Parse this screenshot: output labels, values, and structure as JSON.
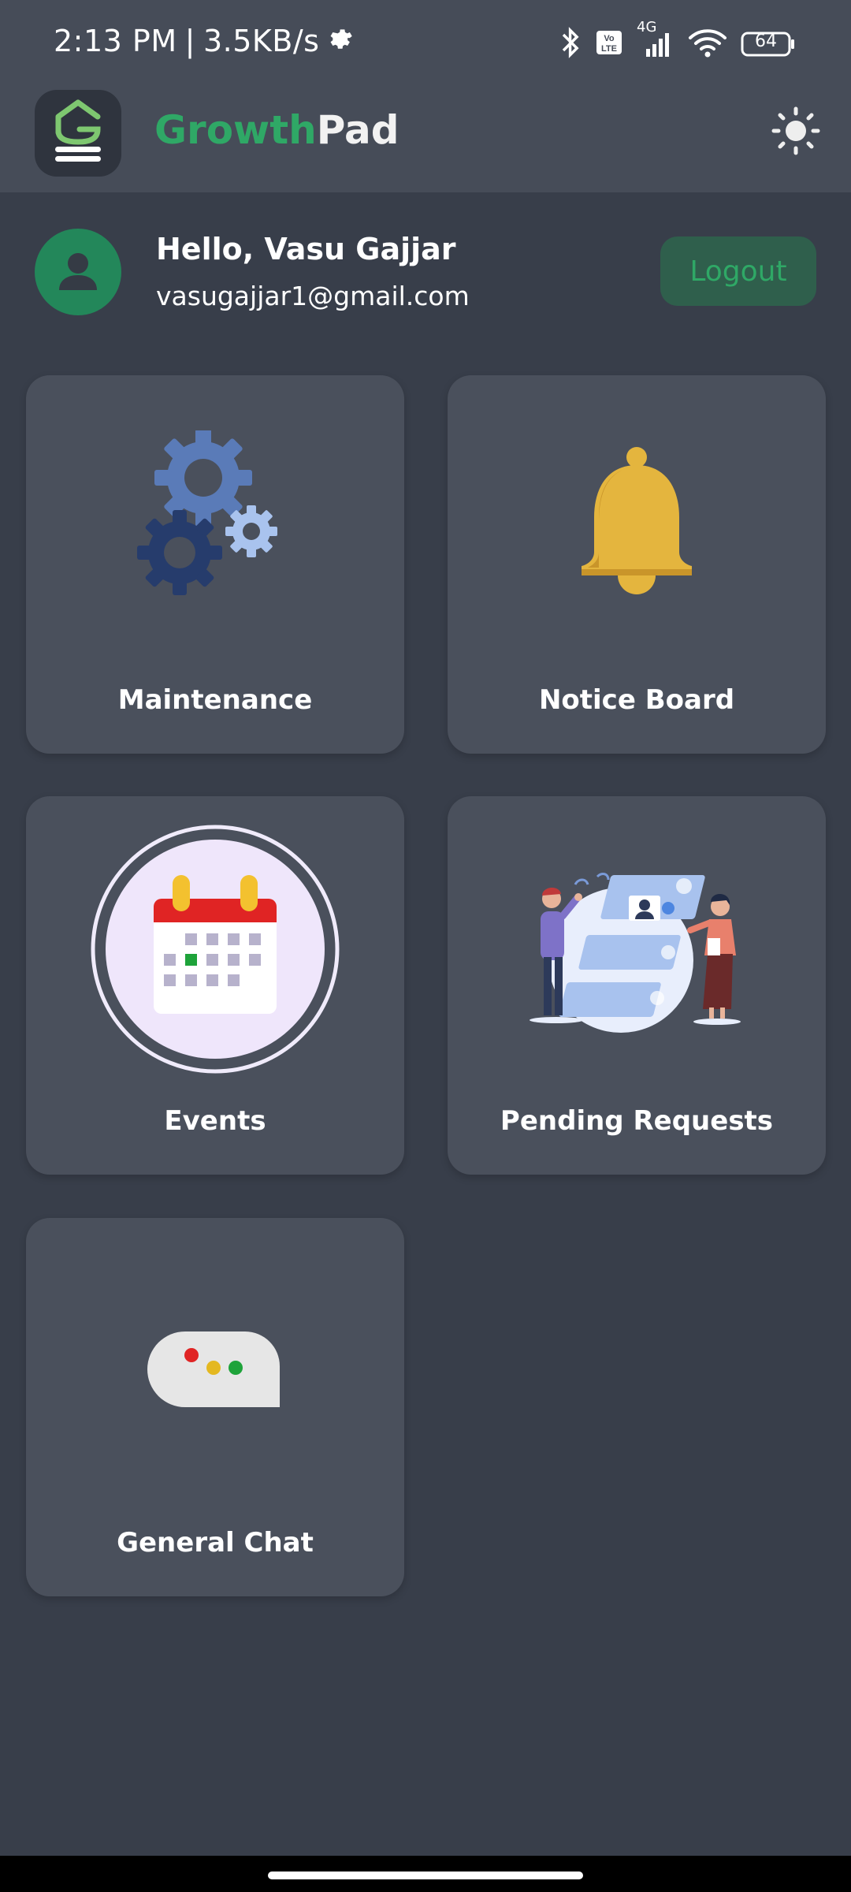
{
  "status_bar": {
    "time": "2:13 PM",
    "separator": "|",
    "speed": "3.5KB/s",
    "network": "4G",
    "volte": "Vo LTE",
    "battery": "64",
    "icons": [
      "settings-icon",
      "bluetooth-icon",
      "volte-icon",
      "signal-icon",
      "wifi-icon",
      "battery-icon"
    ]
  },
  "app_bar": {
    "title_part1": "Growth",
    "title_part2": "Pad",
    "theme_icon": "sun-icon"
  },
  "profile": {
    "greeting": "Hello, Vasu Gajjar",
    "email": "vasugajjar1@gmail.com",
    "logout_label": "Logout"
  },
  "cards": [
    {
      "label": "Maintenance",
      "icon": "gears-icon"
    },
    {
      "label": "Notice Board",
      "icon": "bell-icon"
    },
    {
      "label": "Events",
      "icon": "calendar-icon"
    },
    {
      "label": "Pending Requests",
      "icon": "requests-illustration"
    },
    {
      "label": "General Chat",
      "icon": "chat-bubble-icon"
    }
  ],
  "colors": {
    "background": "#383e4a",
    "card": "#4a505c",
    "brand_green": "#2fa866",
    "bell": "#e4b53e",
    "gear_blue": "#5878b4"
  }
}
